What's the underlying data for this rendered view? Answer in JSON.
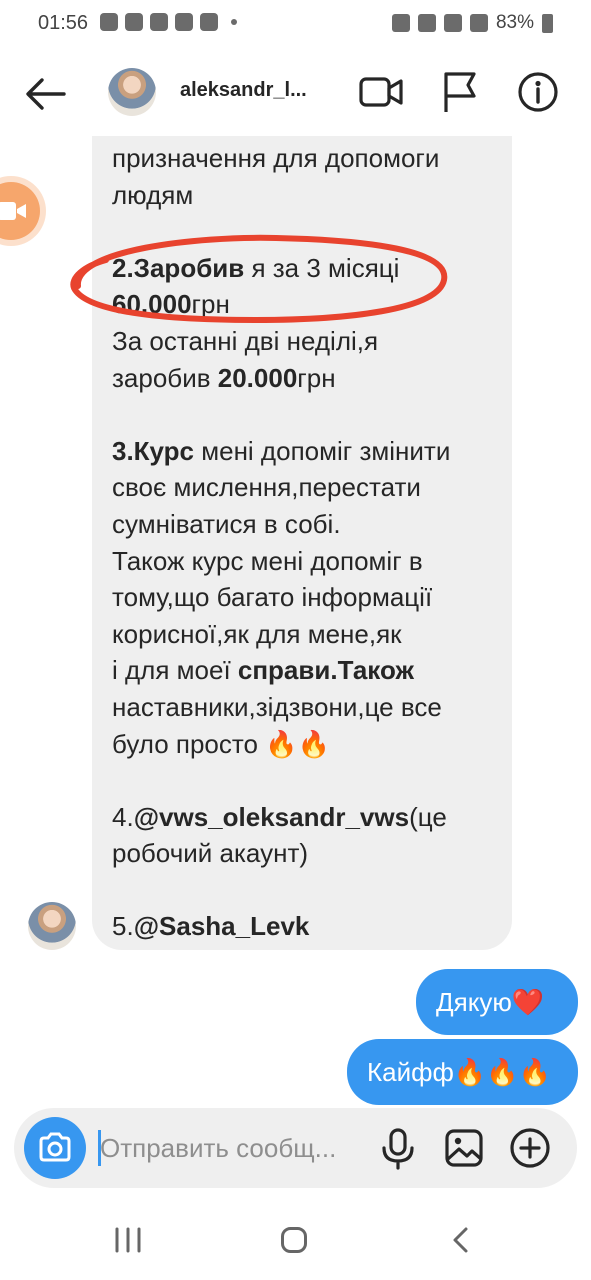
{
  "status_bar": {
    "time": "01:56",
    "battery": "83%"
  },
  "header": {
    "username": "aleksandr_l..."
  },
  "received_message": {
    "lines": [
      {
        "parts": [
          {
            "text": "призначення для допомоги",
            "bold": false
          }
        ]
      },
      {
        "parts": [
          {
            "text": "людям",
            "bold": false
          }
        ]
      },
      {
        "gap": true
      },
      {
        "parts": [
          {
            "text": "2.Заробив",
            "bold": true
          },
          {
            "text": " я за 3 місяці",
            "bold": false
          }
        ]
      },
      {
        "parts": [
          {
            "text": "60.000",
            "bold": true
          },
          {
            "text": "грн",
            "bold": false
          }
        ]
      },
      {
        "parts": [
          {
            "text": "За останні дві неділі,я",
            "bold": false
          }
        ]
      },
      {
        "parts": [
          {
            "text": "заробив ",
            "bold": false
          },
          {
            "text": "20.000",
            "bold": true
          },
          {
            "text": "грн",
            "bold": false
          }
        ]
      },
      {
        "gap": true
      },
      {
        "parts": [
          {
            "text": "3.Курс",
            "bold": true
          },
          {
            "text": " мені допоміг змінити",
            "bold": false
          }
        ]
      },
      {
        "parts": [
          {
            "text": "своє мислення,перестати",
            "bold": false
          }
        ]
      },
      {
        "parts": [
          {
            "text": "сумніватися в собі.",
            "bold": false
          }
        ]
      },
      {
        "parts": [
          {
            "text": "Також курс мені допоміг в",
            "bold": false
          }
        ]
      },
      {
        "parts": [
          {
            "text": "тому,що багато інформації",
            "bold": false
          }
        ]
      },
      {
        "parts": [
          {
            "text": "корисної,як для мене,як",
            "bold": false
          }
        ]
      },
      {
        "parts": [
          {
            "text": "і для моеї ",
            "bold": false
          },
          {
            "text": "справи.Також",
            "bold": true
          }
        ]
      },
      {
        "parts": [
          {
            "text": "наставники,зідзвони,це все",
            "bold": false
          }
        ]
      },
      {
        "parts": [
          {
            "text": "було просто 🔥🔥",
            "bold": false
          }
        ]
      },
      {
        "gap": true
      },
      {
        "parts": [
          {
            "text": "4.",
            "bold": false
          },
          {
            "text": "@vws_oleksandr_vws",
            "bold": true
          },
          {
            "text": "(це",
            "bold": false
          }
        ]
      },
      {
        "parts": [
          {
            "text": "робочий акаунт)",
            "bold": false
          }
        ]
      },
      {
        "gap": true
      },
      {
        "parts": [
          {
            "text": "5.",
            "bold": false
          },
          {
            "text": "@Sasha_Levk",
            "bold": true
          }
        ]
      }
    ]
  },
  "sent_messages": [
    {
      "text": "Дякую❤️"
    },
    {
      "text": "Кайфф🔥🔥🔥"
    }
  ],
  "composer": {
    "placeholder": "Отправить сообщ..."
  },
  "colors": {
    "accent": "#3797f0",
    "highlight_ellipse": "#e8432e",
    "bubble_in": "#efefef"
  }
}
